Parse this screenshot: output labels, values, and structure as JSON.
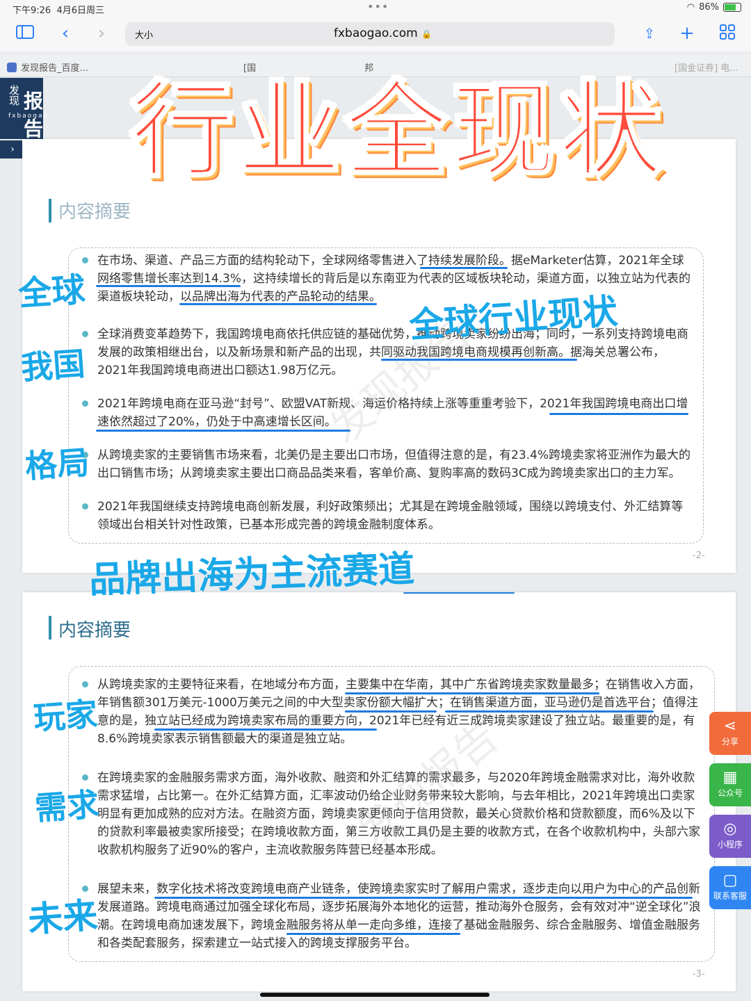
{
  "status": {
    "time": "下午9:26",
    "date": "4月6日周三",
    "battery_pct": "86%"
  },
  "toolbar": {
    "reader_label": "大小",
    "domain": "fxbaogao.com"
  },
  "tabs": [
    "发现报告_百度...",
    "[国",
    "邦",
    "[国金证券] 电..."
  ],
  "logo": {
    "line1": "发现",
    "line2": "报告",
    "sub": "fxbaogao"
  },
  "banner": "行业全现状",
  "page1": {
    "section_title": "内容摘要",
    "bullets": [
      "在市场、渠道、产品三方面的结构轮动下，全球网络零售进入了持续发展阶段。据eMarketer估算，2021年全球网络零售增长率达到14.3%，这持续增长的背后是以东南亚为代表的区域板块轮动，渠道方面，以独立站为代表的渠道板块轮动，以品牌出海为代表的产品轮动的结果。",
      "全球消费变革趋势下，我国跨境电商依托供应链的基础优势，推动跨境卖家纷纷出海；同时，一系列支持跨境电商发展的政策相继出台，以及新场景和新产品的出现，共同驱动我国跨境电商规模再创新高。据海关总署公布，2021年我国跨境电商进出口额达1.98万亿元。",
      "2021年跨境电商在亚马逊“封号”、欧盟VAT新规、海运价格持续上涨等重重考验下，2021年我国跨境电商出口增速依然超过了20%，仍处于中高速增长区间。",
      "从跨境卖家的主要销售市场来看，北美仍是主要出口市场，但值得注意的是，有23.4%跨境卖家将亚洲作为最大的出口销售市场；从跨境卖家主要出口商品品类来看，客单价高、复购率高的数码3C成为跨境卖家出口的主力军。",
      "2021年我国继续支持跨境电商创新发展，利好政策频出；尤其是在跨境金融领域，围绕以跨境支付、外汇结算等领域出台相关针对性政策，已基本形成完善的跨境金融制度体系。"
    ],
    "page_no": "-2-"
  },
  "page2": {
    "section_title": "内容摘要",
    "bullets": [
      "从跨境卖家的主要特征来看，在地域分布方面，主要集中在华南，其中广东省跨境卖家数量最多；在销售收入方面，年销售额301万美元-1000万美元之间的中大型卖家份额大幅扩大；在销售渠道方面，亚马逊仍是首选平台；值得注意的是，独立站已经成为跨境卖家布局的重要方向，2021年已经有近三成跨境卖家建设了独立站。最重要的是，有8.6%跨境卖家表示销售额最大的渠道是独立站。",
      "在跨境卖家的金融服务需求方面，海外收款、融资和外汇结算的需求最多，与2020年跨境金融需求对比，海外收款需求猛增，占比第一。在外汇结算方面，汇率波动仍给企业财务带来较大影响，与去年相比，2021年跨境出口卖家明显有更加成熟的应对方法。在融资方面，跨境卖家更倾向于信用贷款，最关心贷款价格和贷款额度，而6%及以下的贷款利率最被卖家所接受；在跨境收款方面，第三方收款工具仍是主要的收款方式，在各个收款机构中，头部六家收款机构服务了近90%的客户，主流收款服务阵营已经基本形成。",
      "展望未来，数字化技术将改变跨境电商产业链条，使跨境卖家实时了解用户需求，逐步走向以用户为中心的产品创新发展道路。跨境电商通过加强全球化布局，逐步拓展海外本地化的运营，推动海外仓服务，会有效对冲“逆全球化”浪潮。在跨境电商加速发展下，跨境金融服务将从单一走向多维，连接了基础金融服务、综合金融服务、增值金融服务和各类配套服务，探索建立一站式接入的跨境支撑服务平台。"
    ],
    "page_no": "-3-"
  },
  "handwriting": {
    "global": "全球",
    "china": "我国",
    "pattern": "格局",
    "global_status": "全球行业现状",
    "brand": "品牌出海为主流赛道",
    "players": "玩家",
    "demand": "需求",
    "future": "未来"
  },
  "watermark": "发现报告",
  "side_buttons": {
    "share": "分享",
    "official": "公众号",
    "mini": "小程序",
    "service": "联系客服"
  },
  "colors": {
    "accent": "#2f7ff7",
    "banner": "#ff4b3a",
    "handwriting": "#1aa8e8",
    "share_btn": "#f26b3a",
    "official_btn": "#39b54a",
    "mini_btn": "#7b5cc9",
    "service_btn": "#2f86f2"
  }
}
